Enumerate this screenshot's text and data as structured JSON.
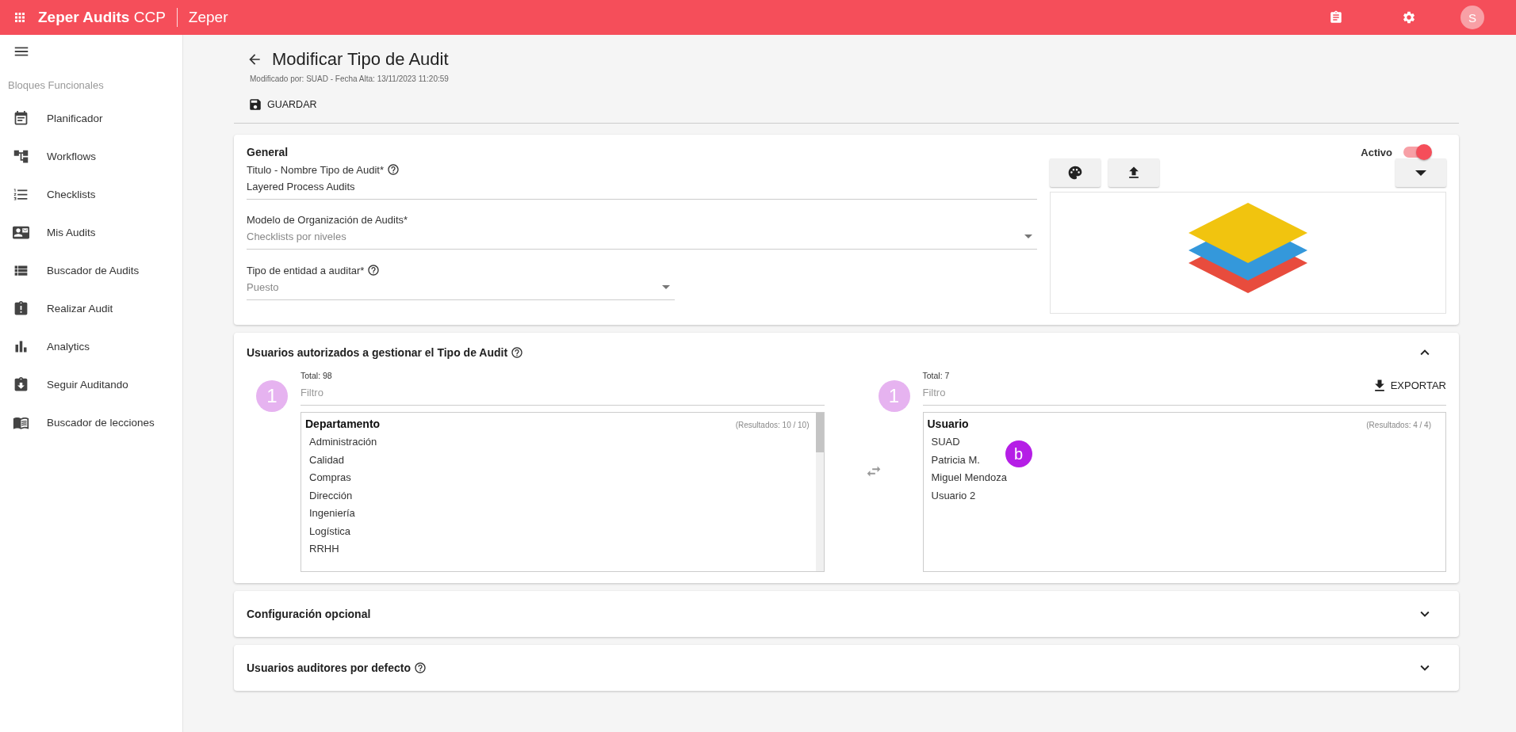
{
  "app": {
    "title": "Zeper Audits",
    "suffix": "CCP",
    "org": "Zeper",
    "avatar": "S"
  },
  "sidebar": {
    "section": "Bloques Funcionales",
    "items": [
      {
        "label": "Planificador"
      },
      {
        "label": "Workflows"
      },
      {
        "label": "Checklists"
      },
      {
        "label": "Mis Audits"
      },
      {
        "label": "Buscador de Audits"
      },
      {
        "label": "Realizar Audit"
      },
      {
        "label": "Analytics"
      },
      {
        "label": "Seguir Auditando"
      },
      {
        "label": "Buscador de lecciones"
      }
    ]
  },
  "page": {
    "title": "Modificar Tipo de Audit",
    "subtitle": "Modificado por: SUAD - Fecha Alta: 13/11/2023 11:20:59",
    "save": "GUARDAR"
  },
  "general": {
    "title": "General",
    "active_label": "Activo",
    "active": true,
    "fields": [
      {
        "label": "Titulo - Nombre Tipo de Audit*",
        "help": true,
        "value": "Layered Process Audits",
        "kind": "text",
        "disabled": false
      },
      {
        "label": "Modelo de Organización de Audits*",
        "help": false,
        "value": "Checklists por niveles",
        "kind": "select",
        "disabled": true
      },
      {
        "label": "Tipo de entidad a auditar*",
        "help": true,
        "value": "Puesto",
        "kind": "select",
        "disabled": true
      }
    ]
  },
  "authorized": {
    "title": "Usuarios autorizados a gestionar el Tipo de Audit",
    "expanded": true,
    "left": {
      "total": "Total: 98",
      "badge": "1",
      "filter_placeholder": "Filtro",
      "header": "Departamento",
      "results": "(Resultados: 10 / 10)",
      "items": [
        "Administración",
        "Calidad",
        "Compras",
        "Dirección",
        "Ingeniería",
        "Logística",
        "RRHH"
      ]
    },
    "right": {
      "total": "Total: 7",
      "badge": "1",
      "filter_placeholder": "Filtro",
      "export": "EXPORTAR",
      "header": "Usuario",
      "results": "(Resultados: 4 / 4)",
      "items": [
        "SUAD",
        "Patricia M.",
        "Miguel Mendoza",
        "Usuario 2"
      ],
      "marker": "b"
    }
  },
  "sections": [
    {
      "title": "Configuración opcional",
      "help": false,
      "expanded": false
    },
    {
      "title": "Usuarios auditores por defecto",
      "help": true,
      "expanded": false
    }
  ]
}
